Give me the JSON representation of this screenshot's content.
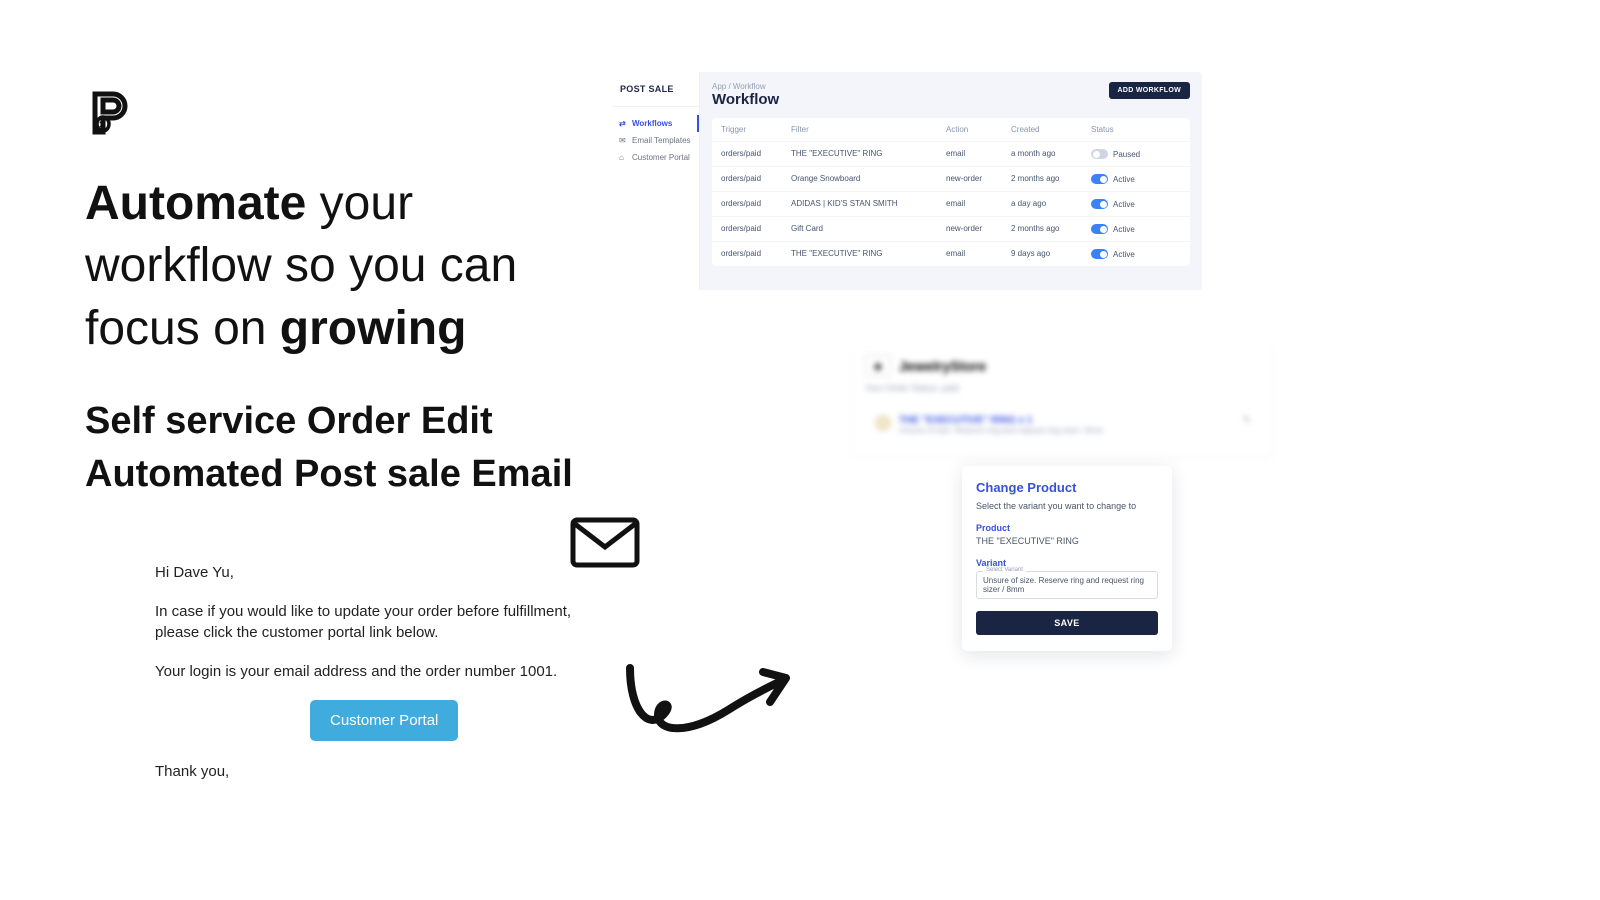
{
  "left": {
    "hl_strong1": "Automate",
    "hl_mid": " your workflow so you can focus on ",
    "hl_strong2": "growing",
    "sub1": "Self service Order Edit",
    "sub2": "Automated Post sale Email"
  },
  "email": {
    "greeting": "Hi Dave Yu,",
    "p1": "In case if you would like to update your order before fulfillment, please click the customer portal link below.",
    "p2": "Your login is your email address and the order number 1001.",
    "btn": "Customer Portal",
    "thanks": "Thank you,"
  },
  "app": {
    "brand": "POST SALE",
    "nav": {
      "workflows": "Workflows",
      "templates": "Email Templates",
      "portal": "Customer Portal"
    },
    "breadcrumb": "App / Workflow",
    "title": "Workflow",
    "add": "ADD WORKFLOW",
    "cols": {
      "trigger": "Trigger",
      "filter": "Filter",
      "action": "Action",
      "created": "Created",
      "status": "Status"
    },
    "rows": [
      {
        "trigger": "orders/paid",
        "filter": "THE \"EXECUTIVE\" RING",
        "action": "email",
        "created": "a month ago",
        "status": "Paused",
        "on": false
      },
      {
        "trigger": "orders/paid",
        "filter": "Orange Snowboard",
        "action": "new-order",
        "created": "2 months ago",
        "status": "Active",
        "on": true
      },
      {
        "trigger": "orders/paid",
        "filter": "ADIDAS | KID'S STAN SMITH",
        "action": "email",
        "created": "a day ago",
        "status": "Active",
        "on": true
      },
      {
        "trigger": "orders/paid",
        "filter": "Gift Card",
        "action": "new-order",
        "created": "2 months ago",
        "status": "Active",
        "on": true
      },
      {
        "trigger": "orders/paid",
        "filter": "THE \"EXECUTIVE\" RING",
        "action": "email",
        "created": "9 days ago",
        "status": "Active",
        "on": true
      }
    ]
  },
  "blur": {
    "store": "JewelryStore",
    "sub": "Your Order Status: paid",
    "item": "THE \"EXECUTIVE\" RING x 1",
    "item2": "Unsure of size. Reserve ring and request ring sizer / 8mm"
  },
  "modal": {
    "title": "Change Product",
    "desc": "Select the variant you want to change to",
    "product_lbl": "Product",
    "product_val": "THE \"EXECUTIVE\" RING",
    "variant_lbl": "Variant",
    "select_tiny": "Select Variant",
    "select_val": "Unsure of size. Reserve ring and request ring sizer / 8mm",
    "save": "SAVE"
  }
}
